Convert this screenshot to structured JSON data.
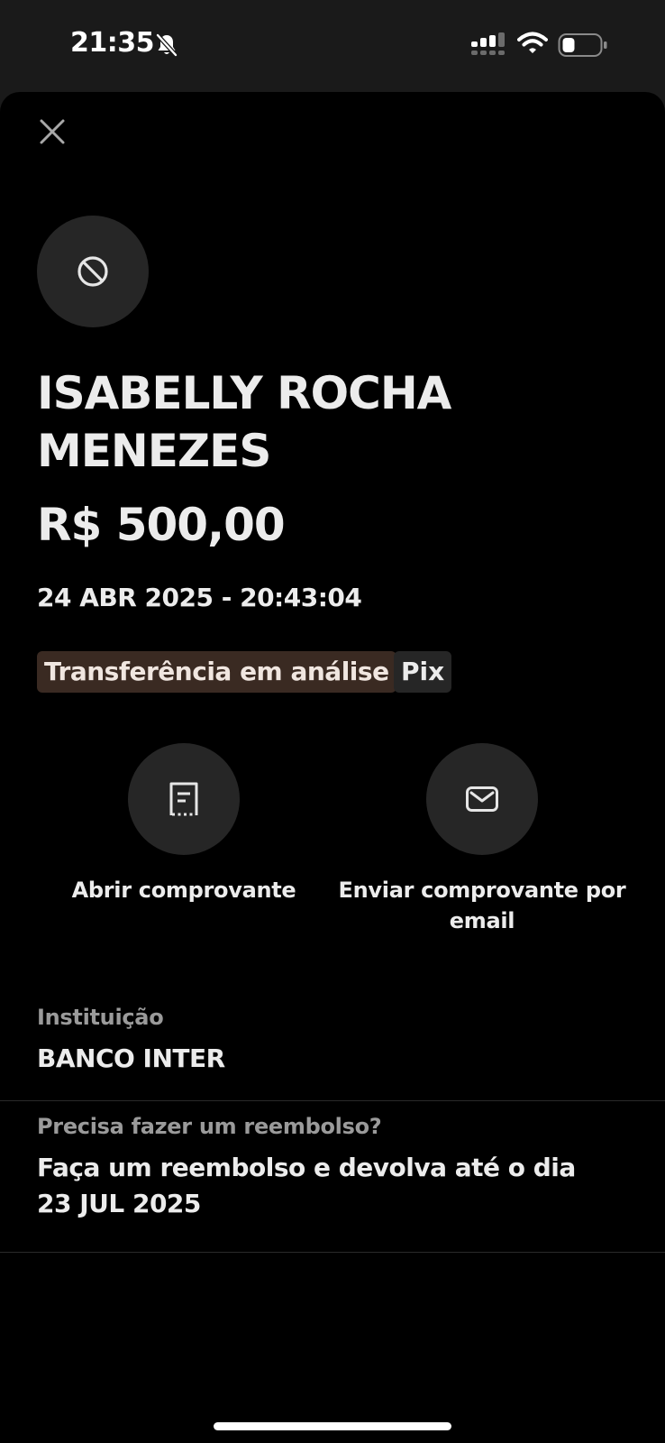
{
  "status_bar": {
    "time": "21:35",
    "icons": [
      "bell-slash-icon",
      "signal-icon",
      "wifi-icon",
      "battery-icon"
    ]
  },
  "header": {
    "close_icon": "close-icon"
  },
  "recipient": {
    "avatar_icon": "blocked-icon",
    "name": "ISABELLY ROCHA MENEZES"
  },
  "transaction": {
    "amount": "R$ 500,00",
    "datetime": "24 ABR 2025 - 20:43:04",
    "status_tag": "Transferência em análise",
    "type_tag": "Pix"
  },
  "actions": [
    {
      "label": "Abrir comprovante",
      "icon": "receipt-icon"
    },
    {
      "label": "Enviar comprovante por email",
      "icon": "mail-icon"
    }
  ],
  "details": {
    "institution_label": "Instituição",
    "institution_value": "BANCO INTER",
    "refund_label": "Precisa fazer um reembolso?",
    "refund_value": "Faça um reembolso e devolva até o dia 23 JUL 2025"
  },
  "colors": {
    "background": "#000000",
    "surface": "#262626",
    "status_tag_bg": "#3a2a22",
    "text_primary": "#ececec",
    "text_secondary": "#9a9a9a"
  }
}
